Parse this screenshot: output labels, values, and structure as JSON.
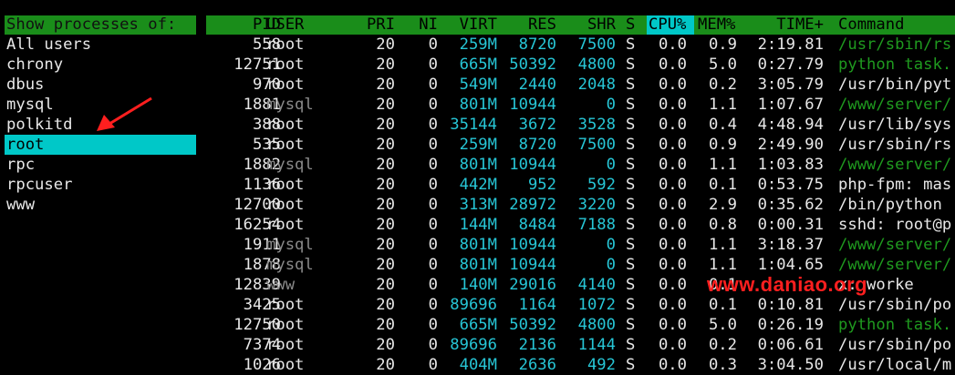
{
  "left_panel": {
    "header": "Show processes of:",
    "users": [
      "All users",
      "chrony",
      "dbus",
      "mysql",
      "polkitd",
      "root",
      "rpc",
      "rpcuser",
      "www"
    ],
    "selected_index": 5
  },
  "columns": [
    "PID",
    "USER",
    "PRI",
    "NI",
    "VIRT",
    "RES",
    "SHR",
    "S",
    "CPU%",
    "MEM%",
    "TIME+",
    "Command"
  ],
  "sort_column": "CPU%",
  "processes": [
    {
      "pid": "558",
      "user": "root",
      "pri": "20",
      "ni": "0",
      "virt": "259M",
      "res": "8720",
      "shr": "7500",
      "s": "S",
      "cpu": "0.0",
      "mem": "0.9",
      "time": "2:19.81",
      "cmd": "/usr/sbin/rs"
    },
    {
      "pid": "12751",
      "user": "root",
      "pri": "20",
      "ni": "0",
      "virt": "665M",
      "res": "50392",
      "shr": "4800",
      "s": "S",
      "cpu": "0.0",
      "mem": "5.0",
      "time": "0:27.79",
      "cmd": "python task."
    },
    {
      "pid": "970",
      "user": "root",
      "pri": "20",
      "ni": "0",
      "virt": "549M",
      "res": "2440",
      "shr": "2048",
      "s": "S",
      "cpu": "0.0",
      "mem": "0.2",
      "time": "3:05.79",
      "cmd": "/usr/bin/pyt"
    },
    {
      "pid": "1881",
      "user": "mysql",
      "pri": "20",
      "ni": "0",
      "virt": "801M",
      "res": "10944",
      "shr": "0",
      "s": "S",
      "cpu": "0.0",
      "mem": "1.1",
      "time": "1:07.67",
      "cmd": "/www/server/"
    },
    {
      "pid": "388",
      "user": "root",
      "pri": "20",
      "ni": "0",
      "virt": "35144",
      "res": "3672",
      "shr": "3528",
      "s": "S",
      "cpu": "0.0",
      "mem": "0.4",
      "time": "4:48.94",
      "cmd": "/usr/lib/sys"
    },
    {
      "pid": "535",
      "user": "root",
      "pri": "20",
      "ni": "0",
      "virt": "259M",
      "res": "8720",
      "shr": "7500",
      "s": "S",
      "cpu": "0.0",
      "mem": "0.9",
      "time": "2:49.90",
      "cmd": "/usr/sbin/rs"
    },
    {
      "pid": "1882",
      "user": "mysql",
      "pri": "20",
      "ni": "0",
      "virt": "801M",
      "res": "10944",
      "shr": "0",
      "s": "S",
      "cpu": "0.0",
      "mem": "1.1",
      "time": "1:03.83",
      "cmd": "/www/server/"
    },
    {
      "pid": "1136",
      "user": "root",
      "pri": "20",
      "ni": "0",
      "virt": "442M",
      "res": "952",
      "shr": "592",
      "s": "S",
      "cpu": "0.0",
      "mem": "0.1",
      "time": "0:53.75",
      "cmd": "php-fpm: mas"
    },
    {
      "pid": "12700",
      "user": "root",
      "pri": "20",
      "ni": "0",
      "virt": "313M",
      "res": "28972",
      "shr": "3220",
      "s": "S",
      "cpu": "0.0",
      "mem": "2.9",
      "time": "0:35.62",
      "cmd": "/bin/python"
    },
    {
      "pid": "16254",
      "user": "root",
      "pri": "20",
      "ni": "0",
      "virt": "144M",
      "res": "8484",
      "shr": "7188",
      "s": "S",
      "cpu": "0.0",
      "mem": "0.8",
      "time": "0:00.31",
      "cmd": "sshd: root@p"
    },
    {
      "pid": "1911",
      "user": "mysql",
      "pri": "20",
      "ni": "0",
      "virt": "801M",
      "res": "10944",
      "shr": "0",
      "s": "S",
      "cpu": "0.0",
      "mem": "1.1",
      "time": "3:18.37",
      "cmd": "/www/server/"
    },
    {
      "pid": "1878",
      "user": "mysql",
      "pri": "20",
      "ni": "0",
      "virt": "801M",
      "res": "10944",
      "shr": "0",
      "s": "S",
      "cpu": "0.0",
      "mem": "1.1",
      "time": "1:04.65",
      "cmd": "/www/server/"
    },
    {
      "pid": "12839",
      "user": "www",
      "pri": "20",
      "ni": "0",
      "virt": "140M",
      "res": "29016",
      "shr": "4140",
      "s": "S",
      "cpu": "0.0",
      "mem": "0.1",
      "time": "",
      "cmd": "x: worke"
    },
    {
      "pid": "3425",
      "user": "root",
      "pri": "20",
      "ni": "0",
      "virt": "89696",
      "res": "1164",
      "shr": "1072",
      "s": "S",
      "cpu": "0.0",
      "mem": "0.1",
      "time": "0:10.81",
      "cmd": "/usr/sbin/po"
    },
    {
      "pid": "12750",
      "user": "root",
      "pri": "20",
      "ni": "0",
      "virt": "665M",
      "res": "50392",
      "shr": "4800",
      "s": "S",
      "cpu": "0.0",
      "mem": "5.0",
      "time": "0:26.19",
      "cmd": "python task."
    },
    {
      "pid": "7374",
      "user": "root",
      "pri": "20",
      "ni": "0",
      "virt": "89696",
      "res": "2136",
      "shr": "1144",
      "s": "S",
      "cpu": "0.0",
      "mem": "0.2",
      "time": "0:06.61",
      "cmd": "/usr/sbin/po"
    },
    {
      "pid": "1026",
      "user": "root",
      "pri": "20",
      "ni": "0",
      "virt": "404M",
      "res": "2636",
      "shr": "492",
      "s": "S",
      "cpu": "0.0",
      "mem": "0.3",
      "time": "3:04.50",
      "cmd": "/usr/local/m"
    }
  ],
  "watermark": "www.daniao.org",
  "colors": {
    "header_green": "#1a8d1a",
    "selection_cyan": "#00c8c8",
    "highlight_cyan": "#27c6d6",
    "dim_user": "#8a8a8a",
    "green_cmd": "#1f9a1f",
    "watermark_red": "#ff1f1f"
  }
}
